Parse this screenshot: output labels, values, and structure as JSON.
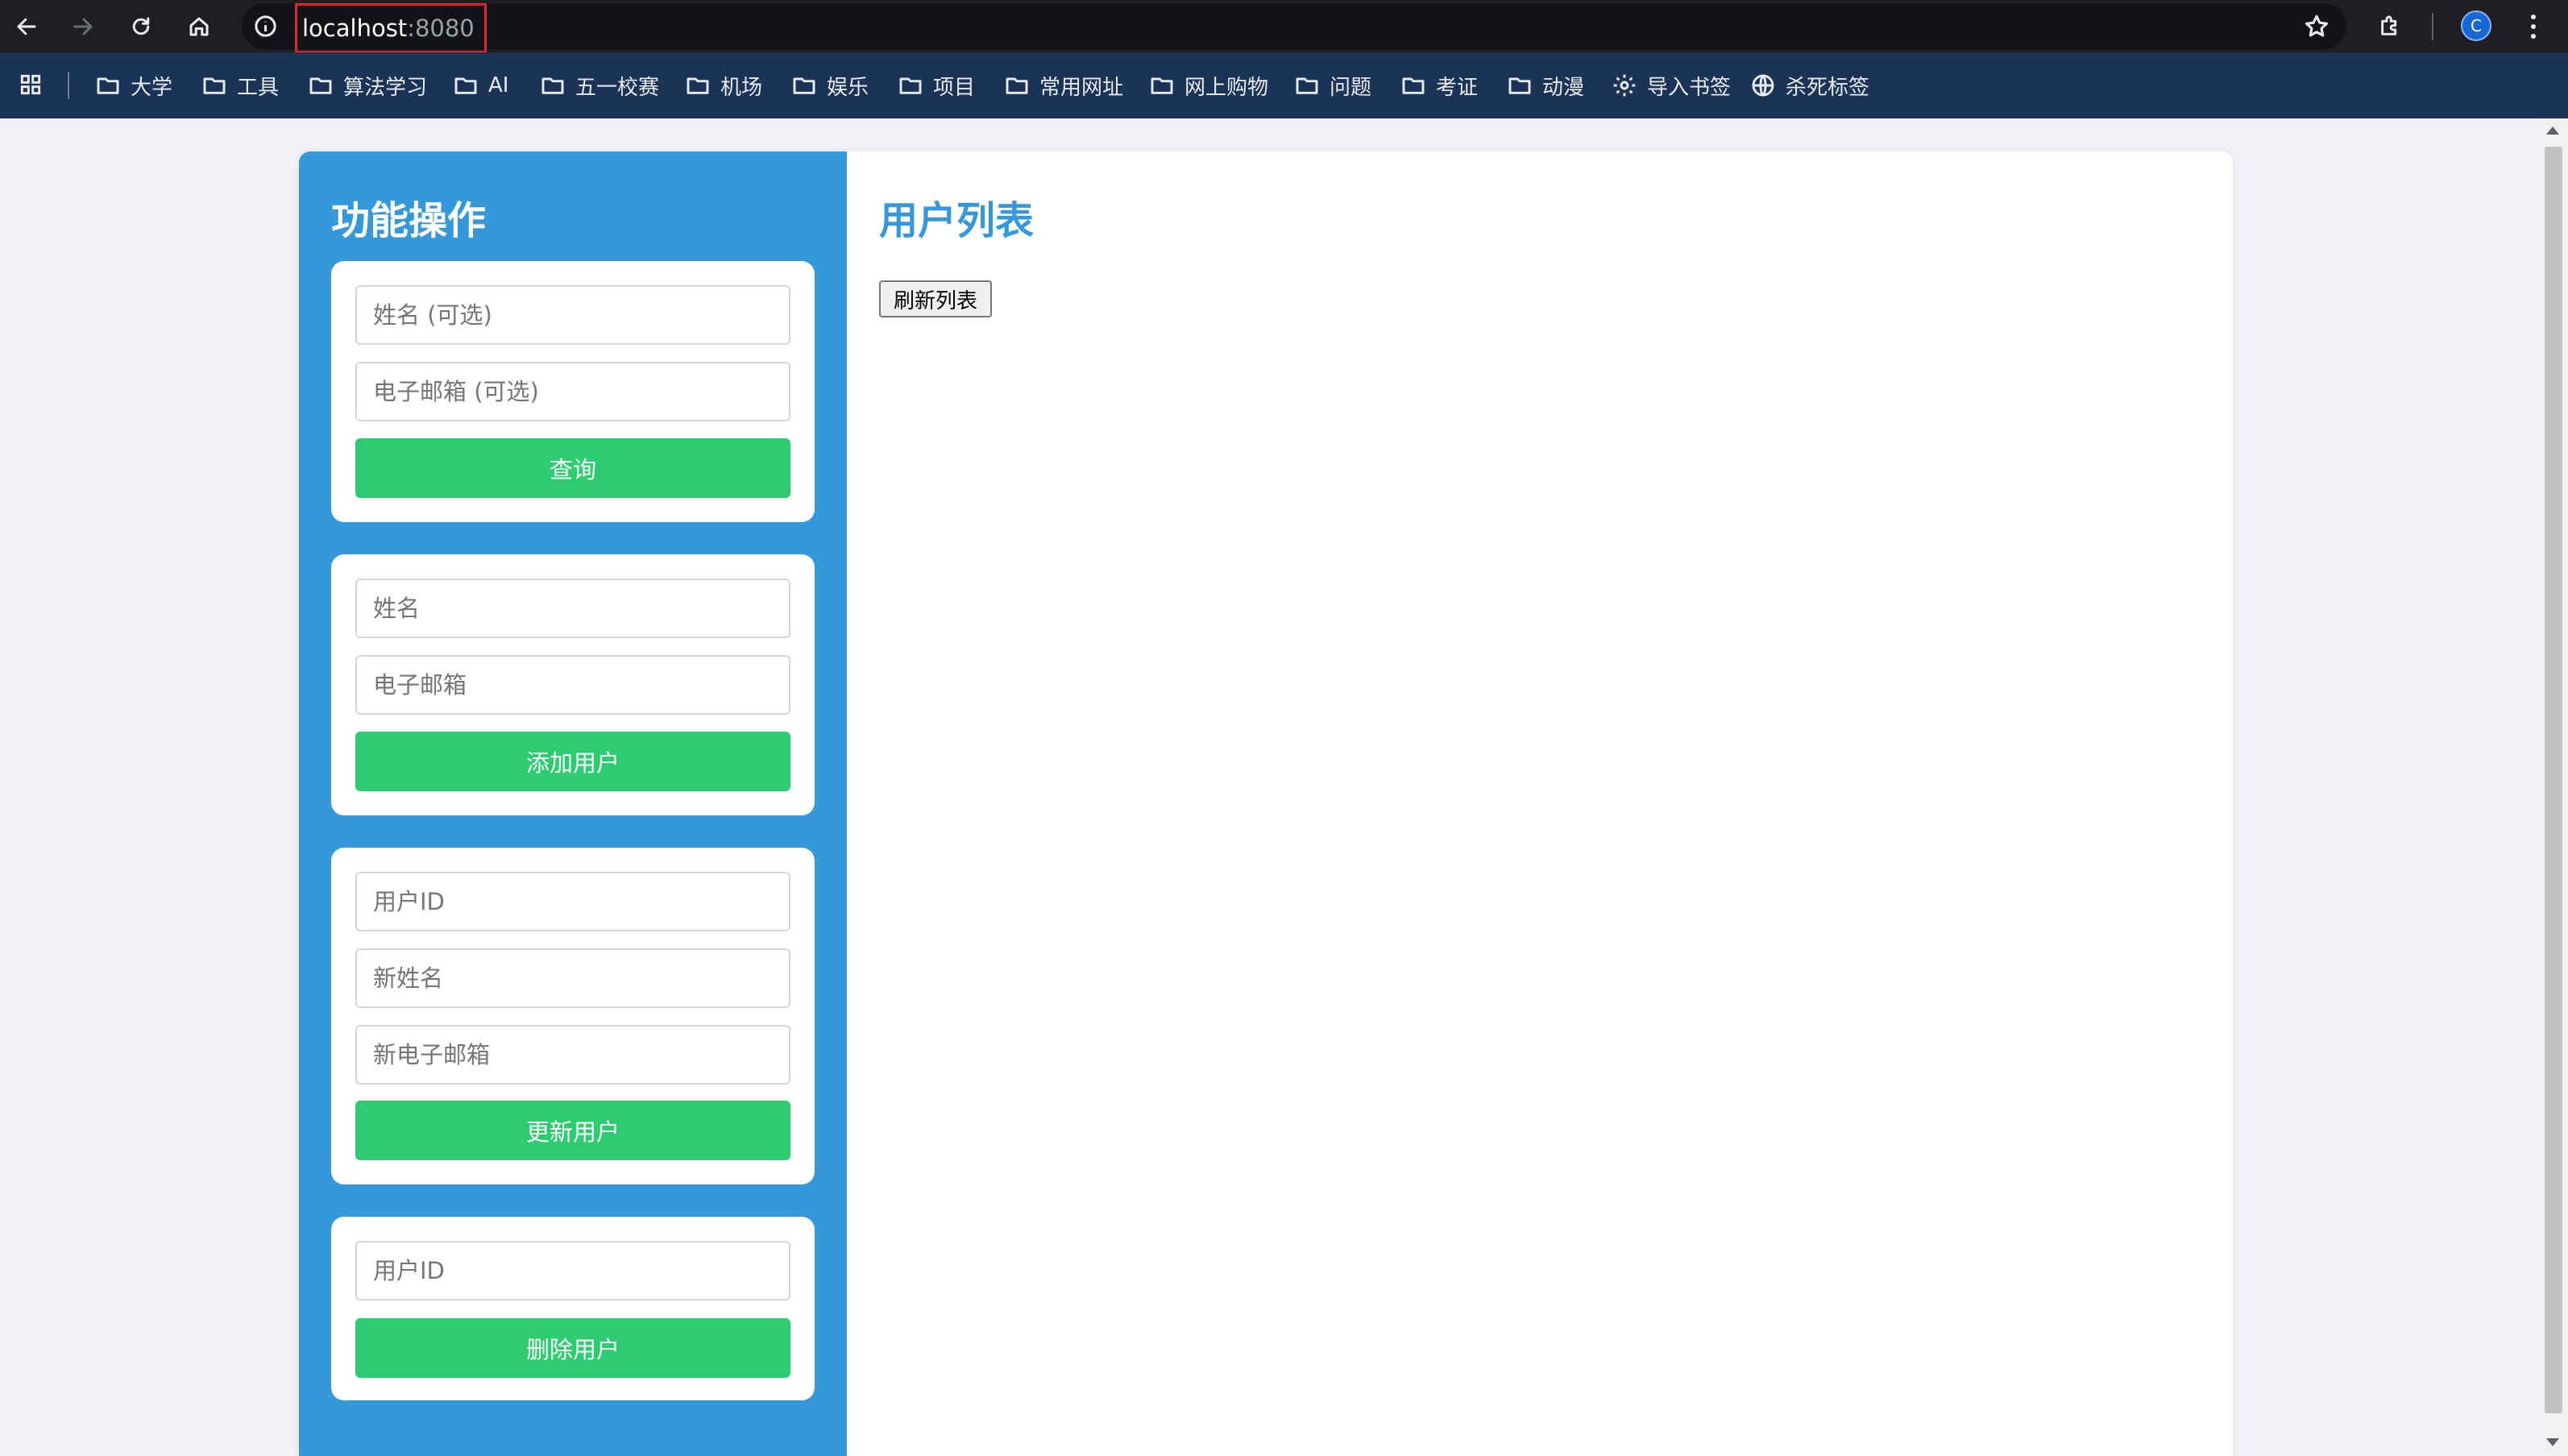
{
  "browser": {
    "url_host": "localhost",
    "url_port": ":8080",
    "profile_initial": "C",
    "icons": {
      "back": "arrow-left-icon",
      "forward": "arrow-right-icon",
      "reload": "reload-icon",
      "home": "home-icon",
      "site_info": "info-icon",
      "bookmark": "star-icon",
      "extensions": "puzzle-icon",
      "menu": "more-vert-icon",
      "apps": "apps-grid-icon"
    }
  },
  "bookmarks": [
    {
      "label": "大学",
      "icon": "folder-icon"
    },
    {
      "label": "工具",
      "icon": "folder-icon"
    },
    {
      "label": "算法学习",
      "icon": "folder-icon"
    },
    {
      "label": "AI",
      "icon": "folder-icon"
    },
    {
      "label": "五一校赛",
      "icon": "folder-icon"
    },
    {
      "label": "机场",
      "icon": "folder-icon"
    },
    {
      "label": "娱乐",
      "icon": "folder-icon"
    },
    {
      "label": "项目",
      "icon": "folder-icon"
    },
    {
      "label": "常用网址",
      "icon": "folder-icon"
    },
    {
      "label": "网上购物",
      "icon": "folder-icon"
    },
    {
      "label": "问题",
      "icon": "folder-icon"
    },
    {
      "label": "考证",
      "icon": "folder-icon"
    },
    {
      "label": "动漫",
      "icon": "folder-icon"
    },
    {
      "label": "导入书签",
      "icon": "gear-icon"
    },
    {
      "label": "杀死标签",
      "icon": "globe-icon"
    }
  ],
  "sidebar": {
    "title": "功能操作",
    "query": {
      "name_placeholder": "姓名 (可选)",
      "email_placeholder": "电子邮箱 (可选)",
      "button": "查询"
    },
    "add": {
      "name_placeholder": "姓名",
      "email_placeholder": "电子邮箱",
      "button": "添加用户"
    },
    "update": {
      "id_placeholder": "用户ID",
      "name_placeholder": "新姓名",
      "email_placeholder": "新电子邮箱",
      "button": "更新用户"
    },
    "delete": {
      "id_placeholder": "用户ID",
      "button": "删除用户"
    }
  },
  "main": {
    "title": "用户列表",
    "refresh_button": "刷新列表"
  },
  "colors": {
    "sidebar": "#3498db",
    "title_accent": "#3498db",
    "button": "#2ecc71",
    "url_highlight": "#e0242a"
  }
}
